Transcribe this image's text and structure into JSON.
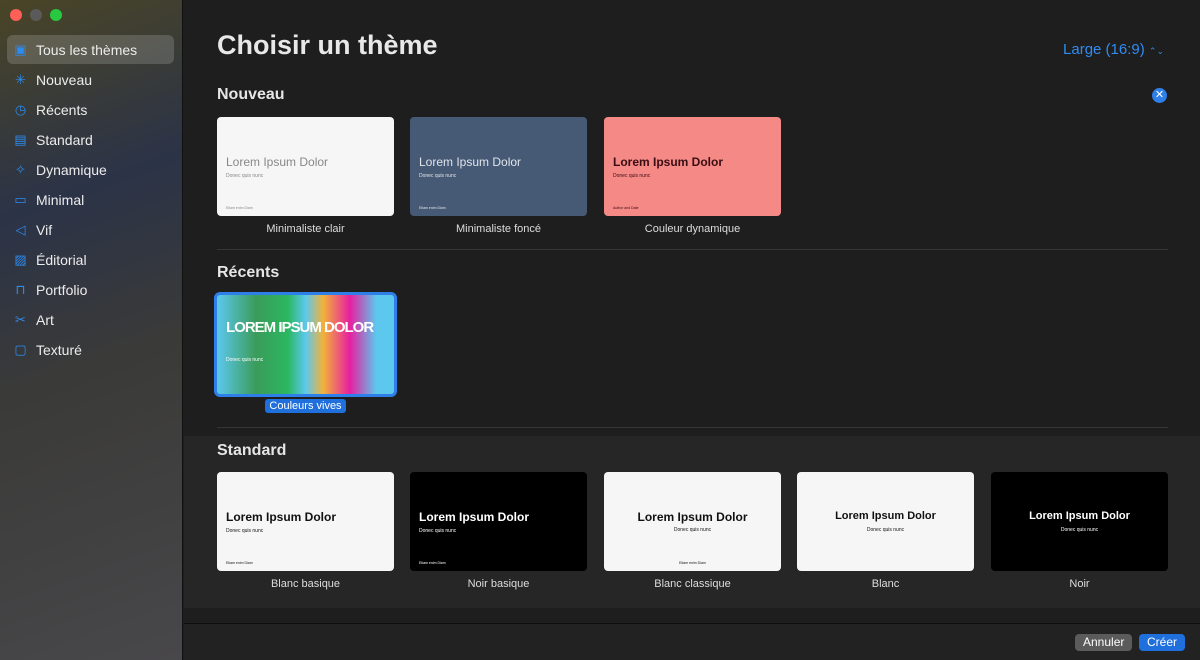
{
  "window": {
    "traffic_lights": [
      "#fe5f57",
      "#5a5a5a",
      "#28c840"
    ]
  },
  "sidebar": {
    "items": [
      {
        "label": "Tous les thèmes",
        "icon": "grid-icon",
        "selected": true
      },
      {
        "label": "Nouveau",
        "icon": "sparkle-burst-icon"
      },
      {
        "label": "Récents",
        "icon": "clock-icon"
      },
      {
        "label": "Standard",
        "icon": "slide-text-icon"
      },
      {
        "label": "Dynamique",
        "icon": "sparkles-icon"
      },
      {
        "label": "Minimal",
        "icon": "slide-minimal-icon"
      },
      {
        "label": "Vif",
        "icon": "megaphone-icon"
      },
      {
        "label": "Éditorial",
        "icon": "photo-icon"
      },
      {
        "label": "Portfolio",
        "icon": "briefcase-icon"
      },
      {
        "label": "Art",
        "icon": "scissors-icon"
      },
      {
        "label": "Texturé",
        "icon": "texture-frame-icon"
      }
    ]
  },
  "header": {
    "title": "Choisir un thème",
    "size_select": "Large (16:9)"
  },
  "sections": {
    "nouveau": {
      "title": "Nouveau",
      "themes": [
        {
          "name": "Minimaliste clair",
          "preview_title": "Lorem Ipsum Dolor",
          "preview_sub": "Donec quis nunc",
          "preview_footer": "Etiam enim Diam",
          "bg": "#f6f6f6",
          "fg": "#888888"
        },
        {
          "name": "Minimaliste foncé",
          "preview_title": "Lorem Ipsum Dolor",
          "preview_sub": "Donec quis nunc",
          "preview_footer": "Etiam enim Diam",
          "bg": "#475a75",
          "fg": "#e0e4ea"
        },
        {
          "name": "Couleur dynamique",
          "preview_title": "Lorem Ipsum Dolor",
          "preview_sub": "Donec quis nunc",
          "preview_footer": "Author and Date",
          "bg": "#f48986",
          "fg": "#3a0d12"
        }
      ]
    },
    "recents": {
      "title": "Récents",
      "themes": [
        {
          "name": "Couleurs vives",
          "preview_title": "LOREM IPSUM DOLOR",
          "preview_sub": "Donec quis nunc",
          "selected": true
        }
      ]
    },
    "standard": {
      "title": "Standard",
      "themes": [
        {
          "name": "Blanc basique",
          "preview_title": "Lorem Ipsum Dolor",
          "preview_sub": "Donec quis nunc",
          "preview_footer": "Etiam enim Diam",
          "bg": "#f6f6f6",
          "fg": "#111111"
        },
        {
          "name": "Noir basique",
          "preview_title": "Lorem Ipsum Dolor",
          "preview_sub": "Donec quis nunc",
          "preview_footer": "Etiam enim Diam",
          "bg": "#000000",
          "fg": "#ffffff"
        },
        {
          "name": "Blanc classique",
          "preview_title": "Lorem Ipsum Dolor",
          "preview_sub": "Donec quis nunc",
          "preview_footer": "Etiam enim Diam",
          "bg": "#f6f6f6",
          "fg": "#111111"
        },
        {
          "name": "Blanc",
          "preview_title": "Lorem Ipsum Dolor",
          "preview_sub": "Donec quis nunc",
          "bg": "#f6f6f6",
          "fg": "#111111"
        },
        {
          "name": "Noir",
          "preview_title": "Lorem Ipsum Dolor",
          "preview_sub": "Donec quis nunc",
          "bg": "#000000",
          "fg": "#ffffff"
        }
      ]
    }
  },
  "footer": {
    "cancel": "Annuler",
    "create": "Créer"
  },
  "colors": {
    "accent": "#2f7fe8"
  }
}
